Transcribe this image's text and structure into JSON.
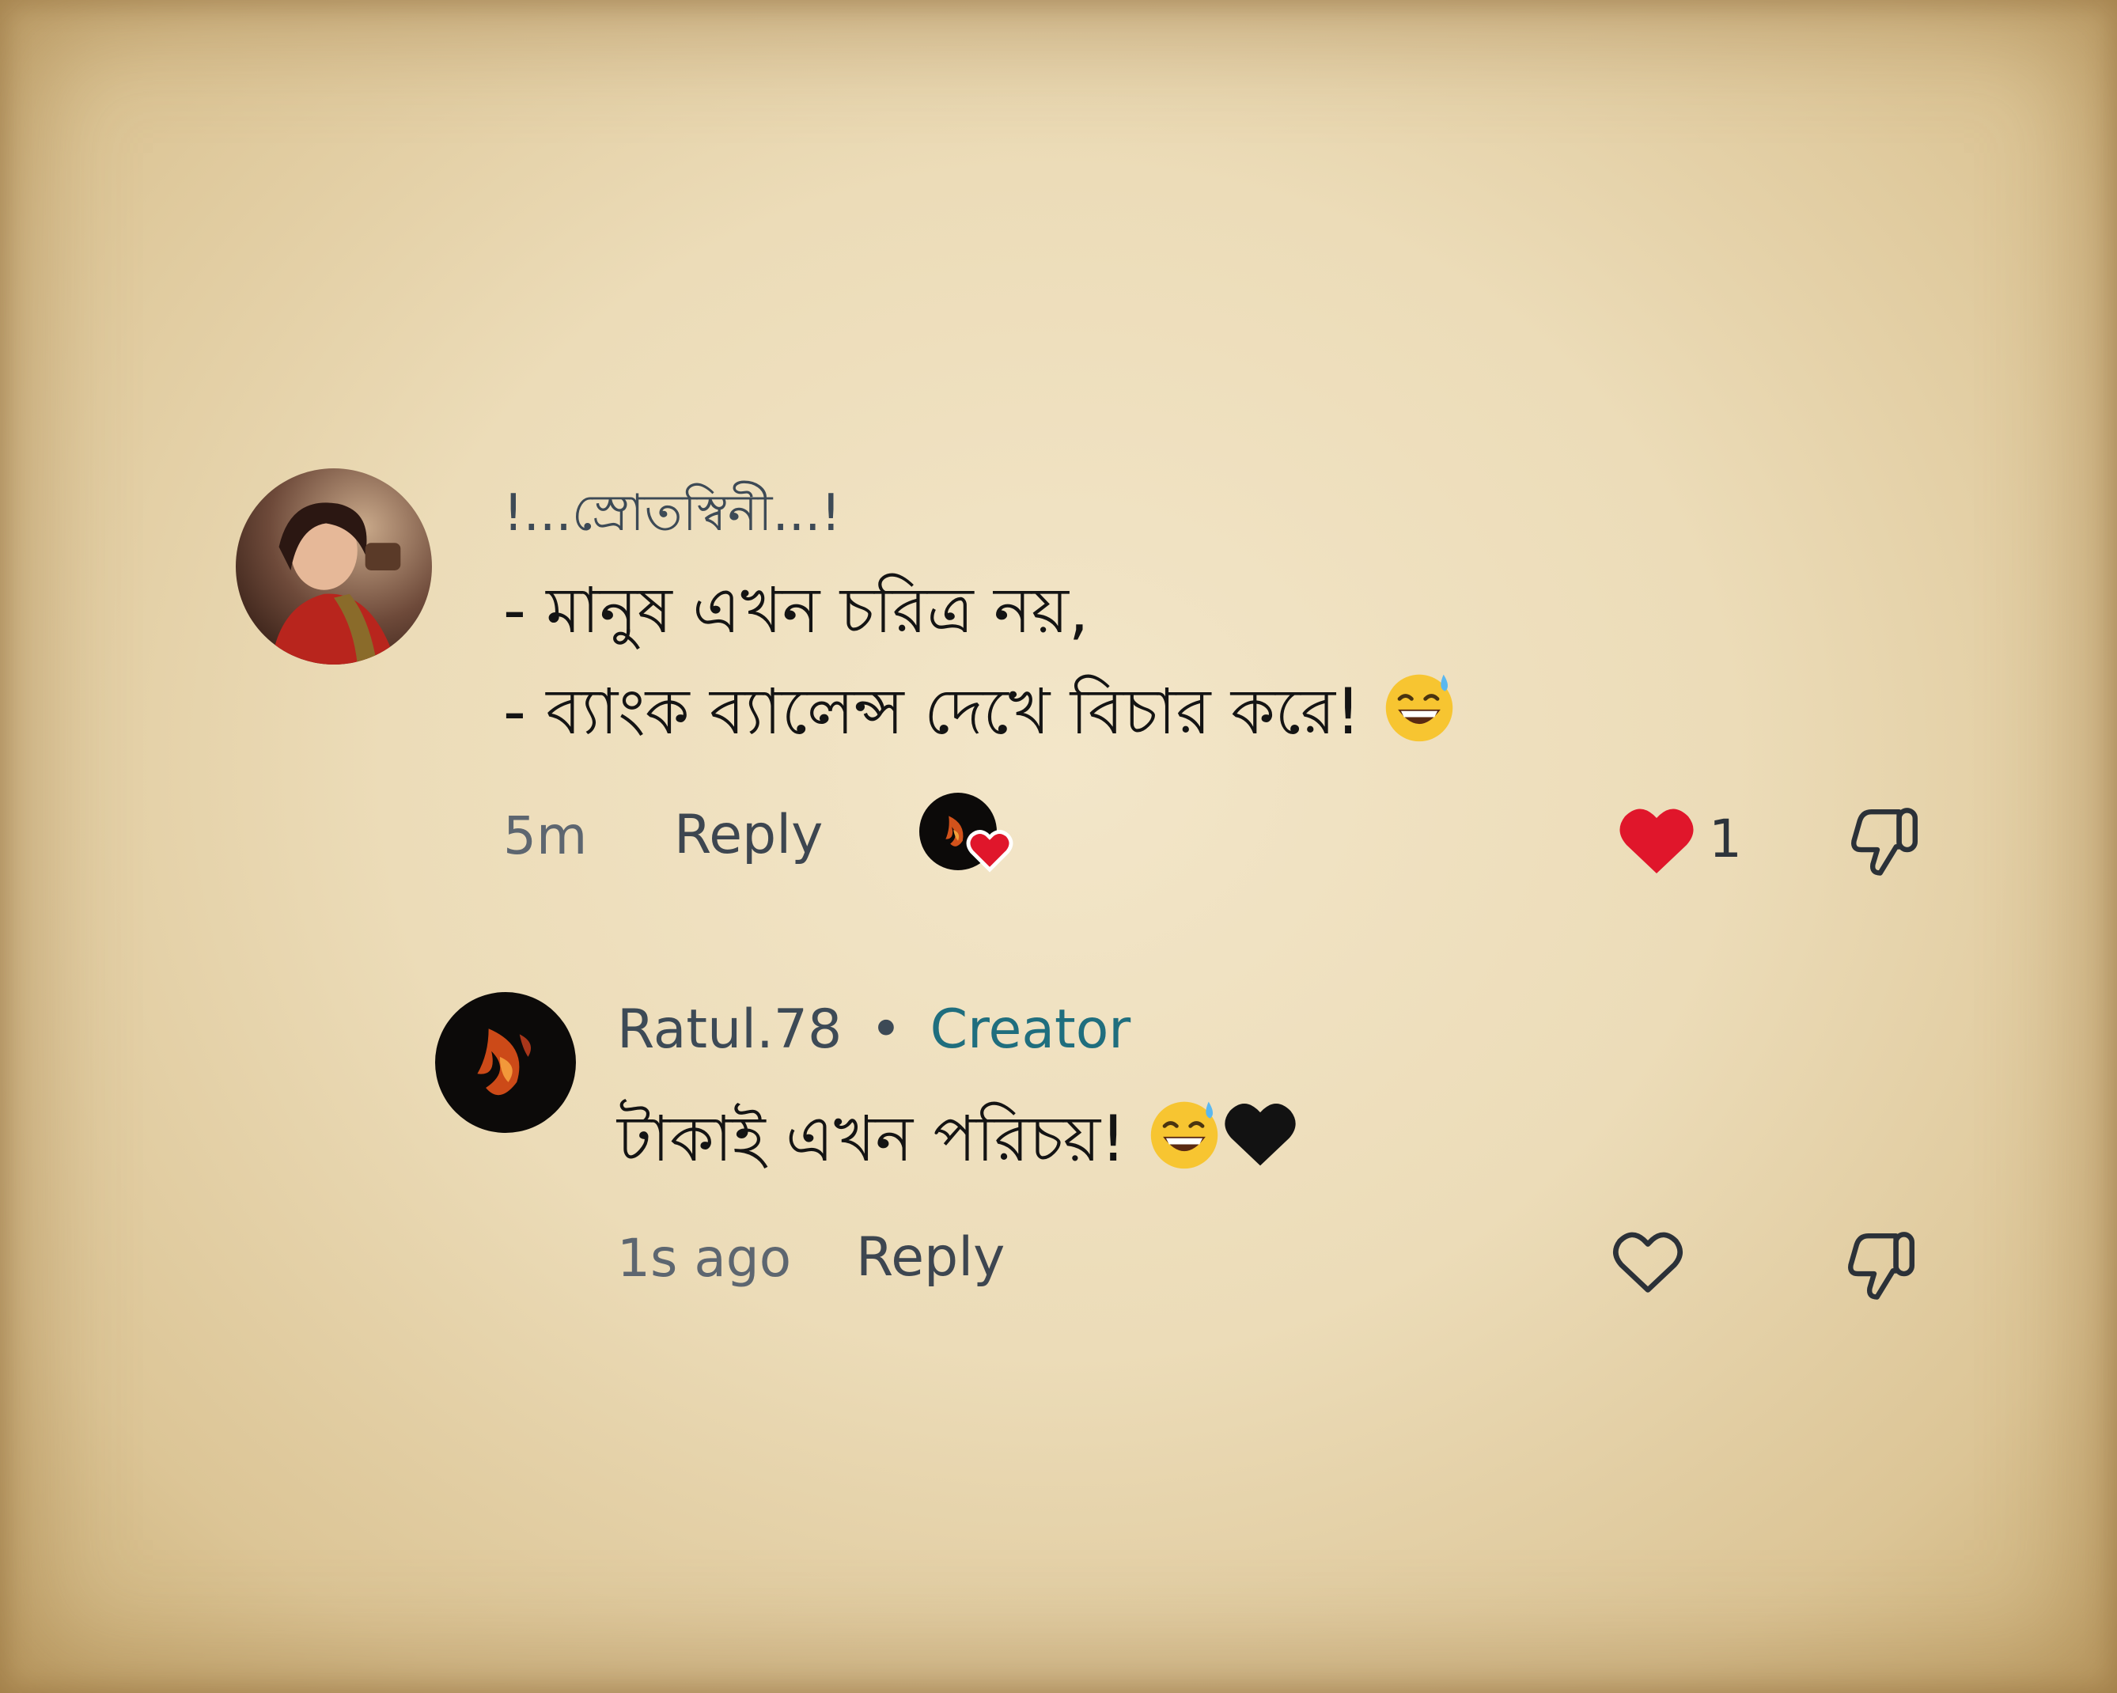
{
  "comments": [
    {
      "username": "!...স্রোতস্বিনী...!",
      "lines": [
        "- মানুষ এখন চরিত্র নয়,",
        "- ব্যাংক ব্যালেন্স দেখে বিচার করে!"
      ],
      "time": "5m",
      "reply_label": "Reply",
      "like_count": "1",
      "liked": true
    },
    {
      "username": "Ratul.78",
      "separator": "•",
      "badge": "Creator",
      "text": "টাকাই এখন পরিচয়!",
      "time": "1s ago",
      "reply_label": "Reply",
      "liked": false
    }
  ],
  "colors": {
    "like_red": "#e0162b",
    "creator_badge": "#1f6e7e",
    "paper": "#ecdcb8"
  },
  "icons": [
    "grinning-sweat-emoji",
    "black-heart-emoji",
    "heart-icon",
    "heart-outline-icon",
    "thumbs-down-icon"
  ]
}
